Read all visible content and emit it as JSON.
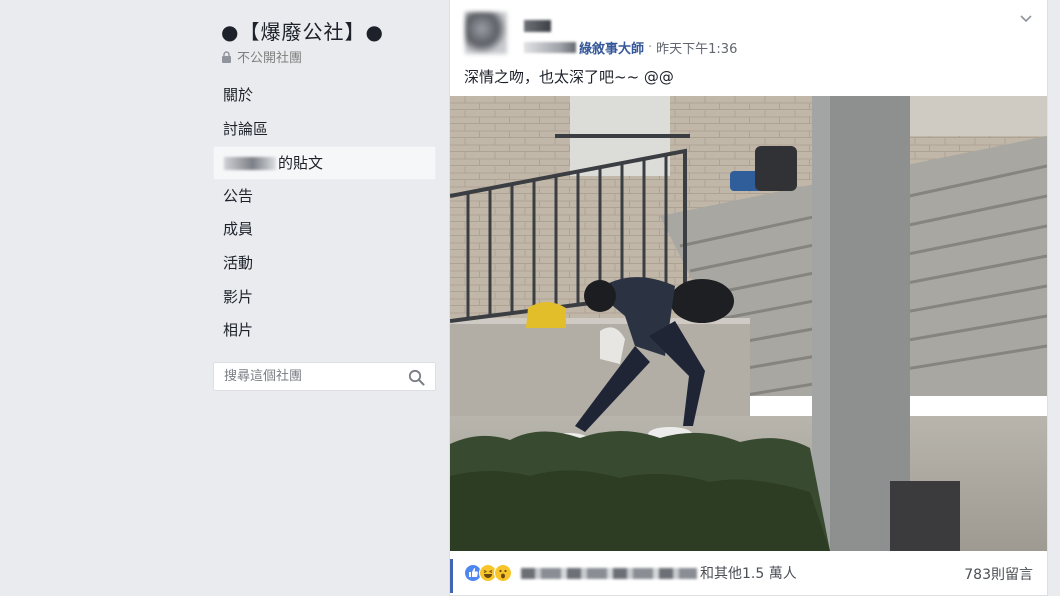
{
  "group": {
    "title": "●【爆廢公社】●",
    "privacy_label": "不公開社團"
  },
  "nav": {
    "items": [
      {
        "label": "關於"
      },
      {
        "label": "討論區"
      },
      {
        "label": "的貼文",
        "active": true
      },
      {
        "label": "公告"
      },
      {
        "label": "成員"
      },
      {
        "label": "活動"
      },
      {
        "label": "影片"
      },
      {
        "label": "相片"
      }
    ]
  },
  "search": {
    "placeholder": "搜尋這個社團",
    "icon": "search-icon"
  },
  "post": {
    "poster_suffix": "綠敘事大師",
    "timestamp": "昨天下午1:36",
    "text": "深情之吻，也太深了吧~~ @@",
    "photo_alt": "photo"
  },
  "footer": {
    "reaction_types": [
      "like",
      "haha",
      "wow"
    ],
    "others_text": "和其他1.5 萬人",
    "comment_count": "783則留言"
  },
  "colors": {
    "page_bg": "#e9ebee",
    "link_blue": "#365899",
    "accent": "#4267b2"
  }
}
